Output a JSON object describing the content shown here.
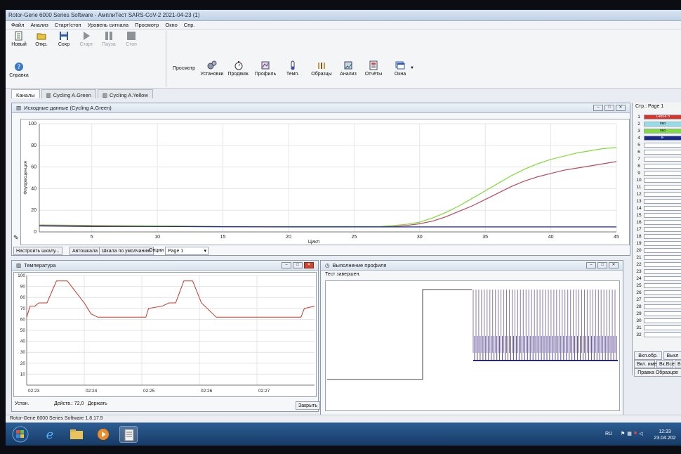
{
  "window": {
    "title": "Rotor-Gene 6000 Series Software - АмплиТест SARS-CoV-2 2021-04-23 (1)"
  },
  "menu": [
    "Файл",
    "Анализ",
    "Старт/стоп",
    "Уровень сигнала",
    "Просмотр",
    "Окно",
    "Спр."
  ],
  "toolbar": {
    "new": "Новый",
    "open": "Откр.",
    "save": "Сохр",
    "start": "Старт",
    "pause": "Пауза",
    "stop": "Стоп",
    "help": "Справка",
    "view_label": "Просмотр",
    "settings": "Установки",
    "prog": "Продвиж.",
    "profile": "Профиль",
    "temp": "Темп.",
    "samples": "Образцы",
    "analysis": "Анализ",
    "reports": "Отчёты",
    "windows": "Окна"
  },
  "tabs": [
    "Каналы",
    "Cycling A.Green",
    "Cycling A.Yellow"
  ],
  "raw_panel": {
    "title": "Исходные данные (Cycling A.Green)",
    "buttons": {
      "scale": "Настроить шкалу...",
      "autoscale": "Автошкала",
      "default_scale": "Шкала по умолчанию",
      "options": "Опции"
    },
    "page_select": "Page 1"
  },
  "chart_data": [
    {
      "type": "line",
      "title": "",
      "xlabel": "Цикл",
      "ylabel": "Флуоресценция",
      "xlim": [
        1,
        45
      ],
      "ylim": [
        0,
        100
      ],
      "xticks": [
        5,
        10,
        15,
        20,
        25,
        30,
        35,
        40,
        45
      ],
      "yticks": [
        0,
        20,
        40,
        60,
        80,
        100
      ],
      "grid": true,
      "series": [
        {
          "color": "#7fdc3a",
          "x": [
            1,
            5,
            10,
            15,
            20,
            25,
            27,
            28,
            29,
            30,
            31,
            32,
            33,
            34,
            35,
            36,
            37,
            38,
            39,
            40,
            41,
            42,
            43,
            44,
            45
          ],
          "values": [
            6.5,
            6,
            5.5,
            5,
            5,
            5,
            5,
            6,
            7,
            9,
            13,
            18,
            24,
            31,
            38,
            45,
            52,
            58,
            63,
            67,
            70,
            73,
            75,
            77,
            78
          ]
        },
        {
          "color": "#b84a5e",
          "x": [
            1,
            5,
            10,
            15,
            20,
            25,
            27,
            28,
            29,
            30,
            31,
            32,
            33,
            34,
            35,
            36,
            37,
            38,
            39,
            40,
            41,
            42,
            43,
            44,
            45
          ],
          "values": [
            6,
            5.5,
            5,
            4.8,
            4.6,
            4.6,
            4.6,
            5,
            6,
            7.5,
            10,
            14,
            19,
            24,
            30,
            36,
            42,
            47,
            51,
            54,
            57,
            59,
            61,
            63,
            65
          ]
        },
        {
          "color": "#1a2a8a",
          "x": [
            1,
            5,
            10,
            15,
            20,
            25,
            30,
            35,
            40,
            45
          ],
          "values": [
            5.5,
            5,
            5,
            4.8,
            4.6,
            4.6,
            4.6,
            4.6,
            4.6,
            4.6
          ]
        }
      ]
    },
    {
      "type": "line",
      "title": "",
      "xticks": [
        "02:23",
        "02:24",
        "02:25",
        "02:26",
        "02:27"
      ],
      "ylim": [
        0,
        100
      ],
      "yticks": [
        10,
        20,
        30,
        40,
        50,
        60,
        70,
        80,
        90,
        100
      ],
      "grid": true,
      "series": [
        {
          "color": "#c0392b",
          "x": [
            0,
            5,
            12,
            18,
            30,
            44,
            60,
            85,
            95,
            105,
            150,
            176,
            180,
            200,
            210,
            220,
            232,
            245,
            258,
            280,
            300,
            330,
            360,
            390,
            405,
            410,
            425
          ],
          "values": [
            62,
            72,
            72,
            75,
            75,
            95,
            95,
            75,
            65,
            62,
            62,
            62,
            70,
            72,
            75,
            75,
            95,
            95,
            75,
            62,
            62,
            62,
            62,
            62,
            62,
            70,
            72
          ]
        }
      ]
    }
  ],
  "temp_panel": {
    "title": "Температура",
    "status_set": "Устан.",
    "status_actual": "Действ.: 72,0",
    "status_hold": "Держать",
    "close": "Закрыть"
  },
  "profile_panel": {
    "title": "Выполнение профиля",
    "status": "Тест завершен."
  },
  "samples_panel": {
    "header": "Стр.: Page 1",
    "rows": [
      {
        "num": "1",
        "label": "14854 п",
        "color": "#d9342b"
      },
      {
        "num": "2",
        "label": "пко",
        "color": "#8fe0e8"
      },
      {
        "num": "3",
        "label": "око",
        "color": "#7fdc3a"
      },
      {
        "num": "4",
        "label": "к-",
        "color": "#1a2a8a"
      },
      {
        "num": "5",
        "label": ""
      },
      {
        "num": "6",
        "label": ""
      },
      {
        "num": "7",
        "label": ""
      },
      {
        "num": "8",
        "label": ""
      },
      {
        "num": "9",
        "label": ""
      },
      {
        "num": "10",
        "label": ""
      },
      {
        "num": "11",
        "label": ""
      },
      {
        "num": "12",
        "label": ""
      },
      {
        "num": "13",
        "label": ""
      },
      {
        "num": "14",
        "label": ""
      },
      {
        "num": "15",
        "label": ""
      },
      {
        "num": "16",
        "label": ""
      },
      {
        "num": "17",
        "label": ""
      },
      {
        "num": "18",
        "label": ""
      },
      {
        "num": "19",
        "label": ""
      },
      {
        "num": "20",
        "label": ""
      },
      {
        "num": "21",
        "label": ""
      },
      {
        "num": "22",
        "label": ""
      },
      {
        "num": "23",
        "label": ""
      },
      {
        "num": "24",
        "label": ""
      },
      {
        "num": "25",
        "label": ""
      },
      {
        "num": "26",
        "label": ""
      },
      {
        "num": "27",
        "label": ""
      },
      {
        "num": "28",
        "label": ""
      },
      {
        "num": "29",
        "label": ""
      },
      {
        "num": "30",
        "label": ""
      },
      {
        "num": "31",
        "label": ""
      },
      {
        "num": "32",
        "label": ""
      }
    ],
    "btn_incl": "Вкл.обр.",
    "btn_excl": "Выкл",
    "btn_incl_name": "Вкл. имен.",
    "btn_all": "Вк.Все",
    "btn_b": "В",
    "btn_edit": "Правка Образцов"
  },
  "statusbar": {
    "text": "Rotor-Gene 6000 Series Software 1.8.17.5"
  },
  "taskbar": {
    "lang": "RU",
    "time": "12:33",
    "date": "23.04.202"
  }
}
